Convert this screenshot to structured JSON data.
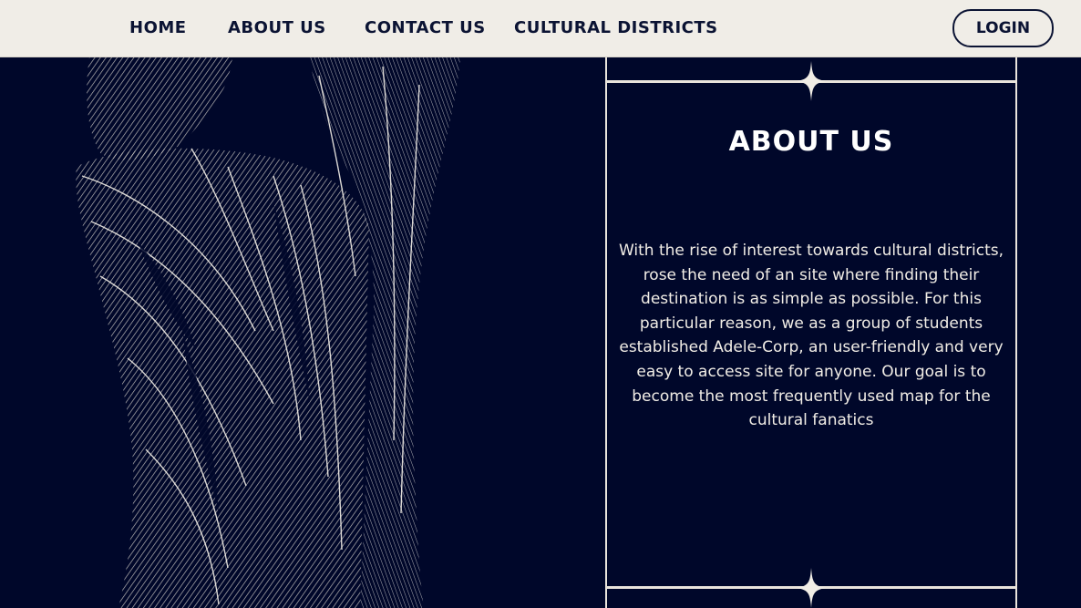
{
  "nav": {
    "items": [
      {
        "label": "HOME"
      },
      {
        "label": "ABOUT US"
      },
      {
        "label": "CONTACT US"
      },
      {
        "label": "CULTURAL DISTRICTS"
      }
    ],
    "login_label": "LOGIN"
  },
  "about": {
    "title": "ABOUT US",
    "body": "With the rise of interest towards cultural districts, rose the need of an site where finding their destination is as simple as possible. For this particular reason, we as a group of students established Adele-Corp, an user-friendly and very easy to access site for anyone. Our goal is to become the most frequently used map for the cultural fanatics"
  },
  "colors": {
    "page_background": "#00072a",
    "navbar_background": "#f0ede7",
    "nav_text": "#0b1333",
    "accent_cream": "#e9e4dc"
  },
  "icons": {
    "divider_ornament": "four-point-star-icon"
  }
}
